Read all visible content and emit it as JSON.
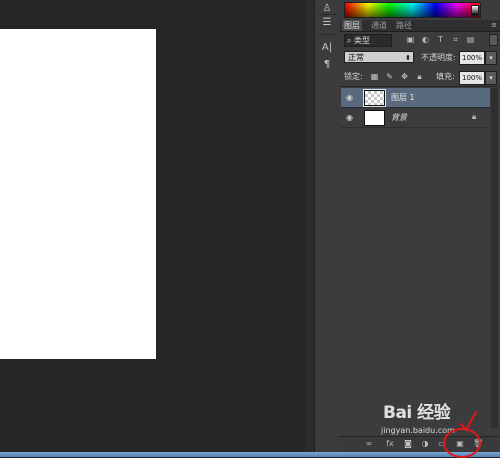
{
  "canvas": {
    "background": "#262527",
    "document_color": "#ffffff"
  },
  "tool_strip": {
    "icons": [
      "brush-icon",
      "adjust-sliders-icon",
      "character-icon",
      "paragraph-icon"
    ]
  },
  "color_panel": {
    "spectrum": "rgb-hue-ramp"
  },
  "layers_panel": {
    "tabs": [
      {
        "label": "图层",
        "active": true
      },
      {
        "label": "通道",
        "active": false
      },
      {
        "label": "路径",
        "active": false
      }
    ],
    "filter": {
      "label": "类型",
      "icons": [
        "image-filter-icon",
        "adjustment-filter-icon",
        "type-filter-icon",
        "shape-filter-icon",
        "smart-object-filter-icon"
      ]
    },
    "blend_mode": "正常",
    "opacity_label": "不透明度:",
    "opacity_value": "100%",
    "lock_label": "锁定:",
    "fill_label": "填充:",
    "fill_value": "100%",
    "layers": [
      {
        "name": "图层 1",
        "selected": true,
        "transparent": true,
        "visible": true
      },
      {
        "name": "背景",
        "selected": false,
        "transparent": false,
        "visible": true,
        "locked": true
      }
    ],
    "footer_icons": [
      "link-icon",
      "fx-icon",
      "mask-icon",
      "adjustment-icon",
      "group-icon",
      "new-layer-icon",
      "trash-icon"
    ],
    "selected_color": "#596a7f"
  },
  "watermark": {
    "text": "Bai 经验",
    "url": "jingyan.baidu.com"
  },
  "annotation": {
    "color": "#e01818"
  }
}
